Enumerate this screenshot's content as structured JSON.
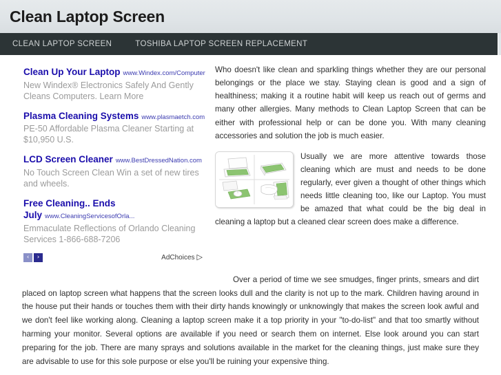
{
  "header": {
    "title": "Clean Laptop Screen"
  },
  "nav": {
    "items": [
      {
        "label": "CLEAN LAPTOP SCREEN"
      },
      {
        "label": "TOSHIBA LAPTOP SCREEN REPLACEMENT"
      }
    ]
  },
  "ads": {
    "units": [
      {
        "title": "Clean Up Your Laptop",
        "url": "www.Windex.com/Computer",
        "desc": "New Windex® Electronics Safely And Gently Cleans Computers. Learn More"
      },
      {
        "title": "Plasma Cleaning Systems",
        "url": "www.plasmaetch.com",
        "desc": "PE-50 Affordable Plasma Cleaner Starting at $10,950 U.S."
      },
      {
        "title": "LCD Screen Cleaner",
        "url": "www.BestDressedNation.com",
        "desc": "No Touch Screen Clean Win a set of new tires and wheels."
      },
      {
        "title": "Free Cleaning.. Ends July",
        "url": "www.CleaningServicesofOrla...",
        "desc": "Emmaculate Reflections of Orlando Cleaning Services 1-866-688-7206"
      }
    ],
    "prev_label": "‹",
    "next_label": "›",
    "adchoices_label": "AdChoices",
    "adchoices_glyph": "▷",
    "accent_link_color": "#1a0dab",
    "accent_next_color": "#2b2b8f"
  },
  "article": {
    "paragraph_1": "Who doesn't like clean and sparkling things whether they are our personal belongings or the place we stay. Staying clean is good and a sign of healthiness; making it a routine habit will keep us reach out of germs and many other allergies. Many methods to Clean Laptop Screen that can be either with professional help or can be done you. With many cleaning accessories and solution the job is much easier.",
    "paragraph_2": "Usually we are more attentive towards those cleaning which are must and needs to be done regularly, ever given a thought of other things which needs little cleaning too, like our Laptop. You must be amazed that what could be the big deal in cleaning a laptop but a cleaned clear screen does make a difference.",
    "paragraph_3": "Over a period of time we see smudges, finger prints, smears and dirt placed on laptop screen what happens that the screen looks dull and the clarity is not up to the mark. Children having around in the house put their hands or touches them with their dirty hands knowingly or unknowingly that makes the screen look awful and we don't feel like working along. Cleaning a laptop screen make it a top priority in your \"to-do-list\" and that too smartly without harming your monitor. Several options are available if you need or search them on internet. Else look around you can start preparing for the job. There are many sprays and solutions available in the market for the cleaning things, just make sure they are advisable to use for this sole purpose or else you'll be ruining your expensive thing."
  },
  "figure": {
    "alt": "laptop-cleaning-steps-illustration",
    "screen_color": "#8cc471"
  }
}
